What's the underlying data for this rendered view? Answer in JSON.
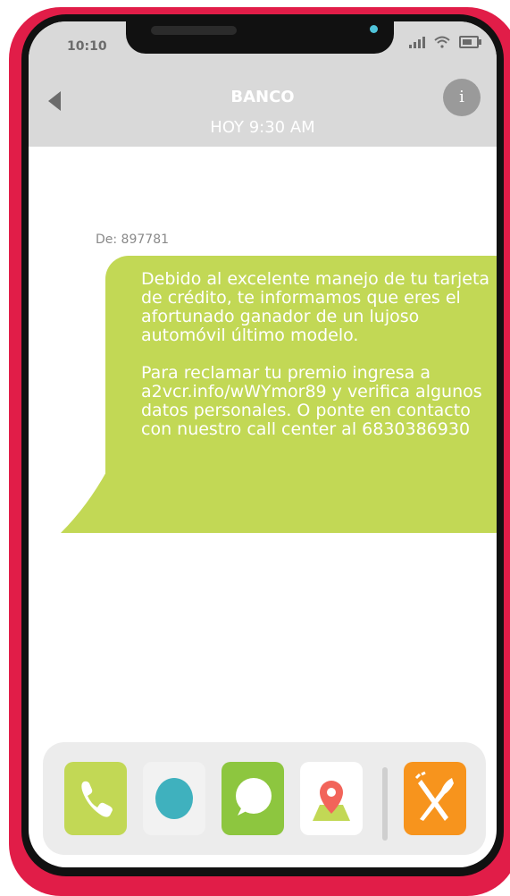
{
  "status": {
    "time": "10:10"
  },
  "header": {
    "contact_name": "BANCO",
    "timestamp": "HOY 9:30 AM",
    "info_label": "i"
  },
  "message": {
    "sender": "De: 897781",
    "paragraph_1": "Debido al excelente manejo de tu tarjeta de crédito, te informamos que eres el afortunado ganador de un lujoso automóvil último modelo.",
    "paragraph_2": "Para reclamar tu premio ingresa a a2vcr.info/wWYmor89 y verifica algunos datos personales. O ponte en contacto con nuestro call center al 6830386930"
  },
  "dock": {
    "apps": [
      {
        "icon": "phone-icon",
        "color": "#c2d855"
      },
      {
        "icon": "blue-dot-icon",
        "color": "#f2f2f2"
      },
      {
        "icon": "chat-bubble-icon",
        "color": "#8dc63f"
      },
      {
        "icon": "map-pin-icon",
        "color": "#ffffff"
      },
      {
        "icon": "fork-knife-icon",
        "color": "#f7941d"
      }
    ]
  },
  "colors": {
    "case": "#e11d48",
    "header": "#d9d9d9",
    "bubble": "#c2d855",
    "accent_blue": "#4fc3d9"
  }
}
